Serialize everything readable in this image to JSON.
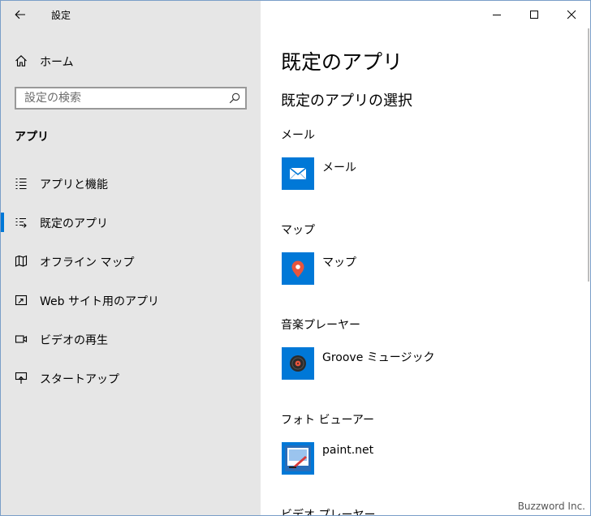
{
  "window": {
    "title": "設定"
  },
  "sidebar": {
    "home_label": "ホーム",
    "search_placeholder": "設定の検索",
    "section_title": "アプリ",
    "items": [
      {
        "label": "アプリと機能",
        "icon": "apps-features-icon",
        "selected": false
      },
      {
        "label": "既定のアプリ",
        "icon": "default-apps-icon",
        "selected": true
      },
      {
        "label": "オフライン マップ",
        "icon": "offline-maps-icon",
        "selected": false
      },
      {
        "label": "Web サイト用のアプリ",
        "icon": "apps-for-websites-icon",
        "selected": false
      },
      {
        "label": "ビデオの再生",
        "icon": "video-playback-icon",
        "selected": false
      },
      {
        "label": "スタートアップ",
        "icon": "startup-icon",
        "selected": false
      }
    ]
  },
  "main": {
    "title": "既定のアプリ",
    "subtitle": "既定のアプリの選択",
    "categories": [
      {
        "label": "メール",
        "app": "メール",
        "icon": "mail-icon"
      },
      {
        "label": "マップ",
        "app": "マップ",
        "icon": "maps-icon"
      },
      {
        "label": "音楽プレーヤー",
        "app": "Groove ミュージック",
        "icon": "groove-music-icon"
      },
      {
        "label": "フォト ビューアー",
        "app": "paint.net",
        "icon": "paint-net-icon"
      },
      {
        "label": "ビデオ プレーヤー"
      }
    ]
  },
  "watermark": "Buzzword Inc.",
  "colors": {
    "accent": "#0078d7",
    "sidebar_bg": "#e6e6e6"
  }
}
